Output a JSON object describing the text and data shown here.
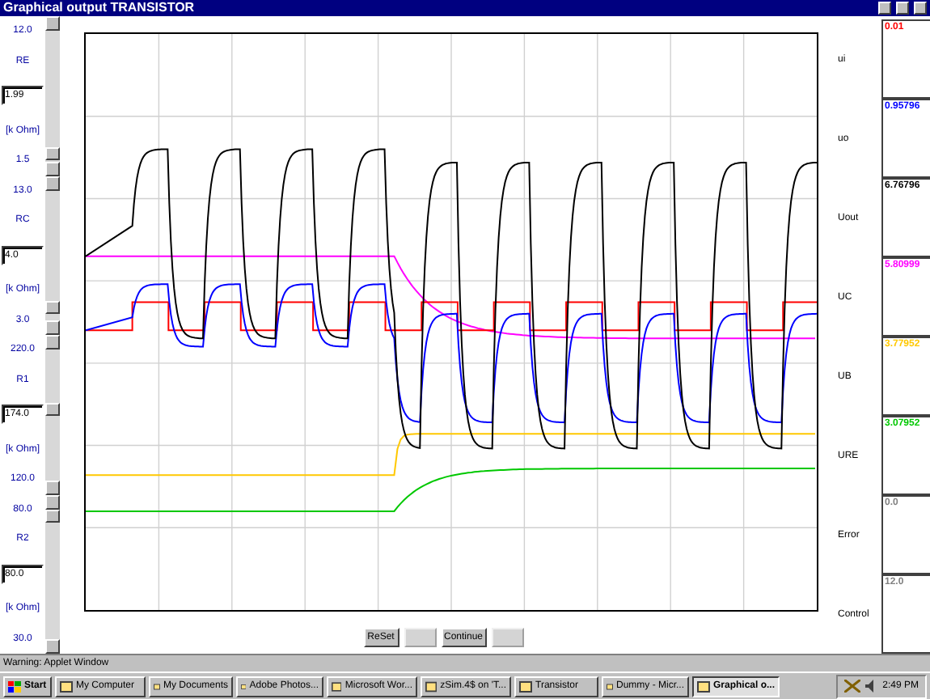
{
  "window": {
    "title": "Graphical output TRANSISTOR"
  },
  "sliders": [
    {
      "max": "12.0",
      "name": "RE",
      "value": "1.99",
      "unit": "[k Ohm]",
      "min": "1.5",
      "level": 0.05
    },
    {
      "max": "13.0",
      "name": "RC",
      "value": "4.0",
      "unit": "[k Ohm]",
      "min": "3.0",
      "level": 0.1
    },
    {
      "max": "220.0",
      "name": "R1",
      "value": "174.0",
      "unit": "[k Ohm]",
      "min": "120.0",
      "level": 0.54
    },
    {
      "max": "80.0",
      "name": "R2",
      "value": "80.0",
      "unit": "[k Ohm]",
      "min": "30.0",
      "level": 1.0
    }
  ],
  "signals": [
    {
      "name": "ui",
      "value": "0.01",
      "color": "#ff0000"
    },
    {
      "name": "uo",
      "value": "0.95796",
      "color": "#0000ff"
    },
    {
      "name": "Uout",
      "value": "6.76796",
      "color": "#000000"
    },
    {
      "name": "UC",
      "value": "5.80999",
      "color": "#ff00ff"
    },
    {
      "name": "UB",
      "value": "3.77952",
      "color": "#ffc800"
    },
    {
      "name": "URE",
      "value": "3.07952",
      "color": "#00c800"
    },
    {
      "name": "Error",
      "value": "0.0",
      "color": "#808080"
    },
    {
      "name": "Control",
      "value": "12.0",
      "color": "#808080"
    }
  ],
  "buttons": [
    {
      "label": "ReSet",
      "disabled": false
    },
    {
      "disabled": true
    },
    {
      "label": "Continue",
      "disabled": false
    },
    {
      "disabled": true
    }
  ],
  "status_bar": "Warning: Applet Window",
  "taskbar": {
    "start": "Start",
    "items": [
      {
        "label": "My Computer",
        "selected": false
      },
      {
        "label": "My Documents",
        "selected": false
      },
      {
        "label": "Adobe Photos...",
        "selected": false
      },
      {
        "label": "Microsoft Wor...",
        "selected": false
      },
      {
        "label": "zSim.4$ on 'T...",
        "selected": false
      },
      {
        "label": "Transistor",
        "selected": false
      },
      {
        "label": "Dummy - Micr...",
        "selected": false
      },
      {
        "label": "Graphical o...",
        "selected": true
      }
    ],
    "clock": "2:49 PM"
  }
}
